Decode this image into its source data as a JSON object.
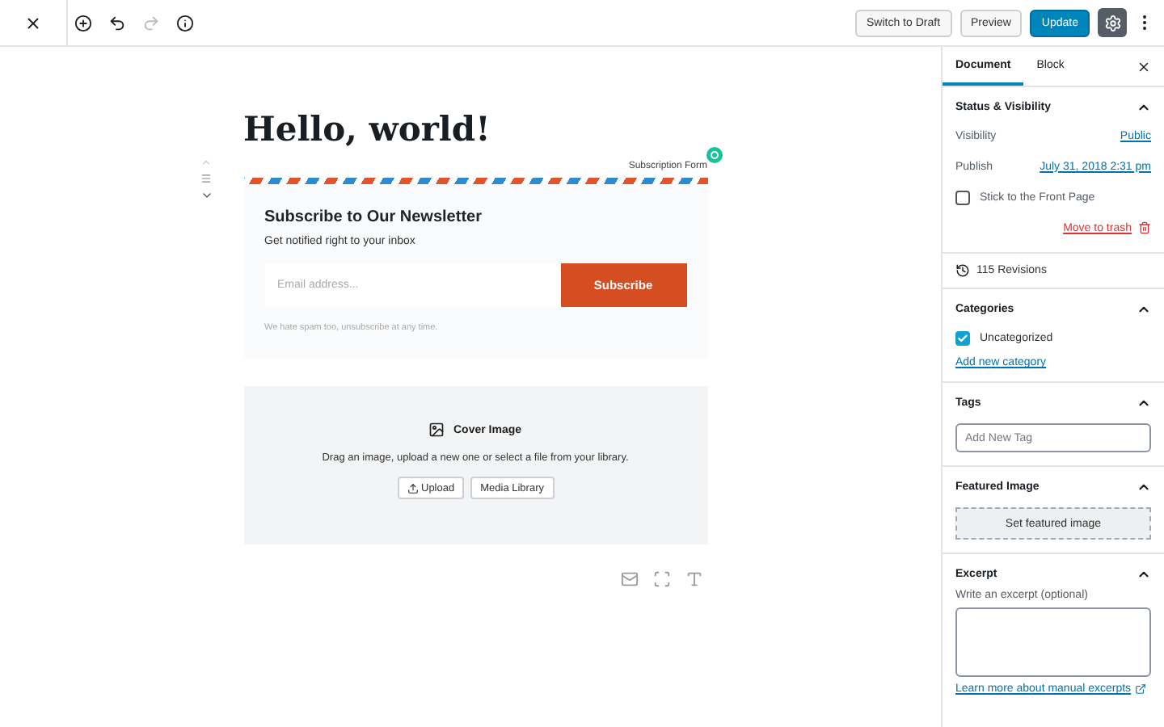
{
  "toolbar": {
    "buttons": [
      {
        "label": "Switch to Draft",
        "kind": "secondary"
      },
      {
        "label": "Preview",
        "kind": "secondary"
      },
      {
        "label": "Update",
        "kind": "primary"
      }
    ],
    "settings_active": true
  },
  "editor": {
    "title": "Hello, world!",
    "subscription_block": {
      "label": "Subscription Form",
      "heading": "Subscribe to Our Newsletter",
      "subheading": "Get notified right to your inbox",
      "email_placeholder": "Email address...",
      "button": "Subscribe",
      "note": "We hate spam too, unsubscribe at any time."
    },
    "cover_block": {
      "title": "Cover Image",
      "instructions": "Drag an image, upload a new one or select a file from your library.",
      "buttons": [
        {
          "label": "Upload",
          "kind": "upload"
        },
        {
          "label": "Media Library",
          "kind": "plain"
        }
      ]
    }
  },
  "sidebar": {
    "tabs": [
      {
        "label": "Document",
        "selected": true
      },
      {
        "label": "Block",
        "selected": false
      }
    ],
    "status": {
      "title": "Status & Visibility",
      "expanded": true,
      "visibility_label": "Visibility",
      "visibility": "Public",
      "publish_label": "Publish",
      "publish": "July 31, 2018 2:31 pm",
      "sticky_label": "Stick to the Front Page",
      "sticky": false,
      "trash": "Move to trash"
    },
    "revisions": "115 Revisions",
    "categories": {
      "title": "Categories",
      "expanded": true,
      "items": [
        {
          "label": "Uncategorized",
          "checked": true
        }
      ],
      "add_link": "Add new category"
    },
    "tags": {
      "title": "Tags",
      "expanded": true,
      "placeholder": "Add New Tag"
    },
    "featured_image": {
      "title": "Featured Image",
      "expanded": true,
      "button": "Set featured image"
    },
    "excerpt": {
      "title": "Excerpt",
      "expanded": true,
      "label": "Write an excerpt (optional)",
      "link": "Learn more about manual excerpts"
    }
  }
}
